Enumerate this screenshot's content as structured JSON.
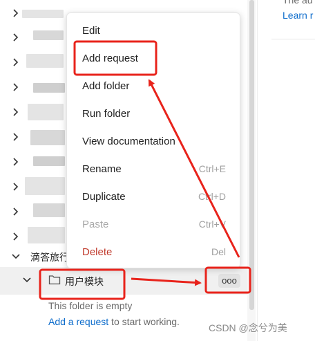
{
  "right_panel": {
    "partial_text": "The au",
    "learn_more": "Learn r"
  },
  "tree": {
    "group_label": "滴答旅行",
    "folder_name": "用户模块",
    "more_label": "ooo",
    "empty_message": "This folder is empty",
    "add_link": "Add a request",
    "add_suffix": " to start working."
  },
  "context_menu": {
    "items": [
      {
        "label": "Edit",
        "shortcut": ""
      },
      {
        "label": "Add request",
        "shortcut": ""
      },
      {
        "label": "Add folder",
        "shortcut": ""
      },
      {
        "label": "Run folder",
        "shortcut": ""
      },
      {
        "label": "View documentation",
        "shortcut": ""
      },
      {
        "label": "Rename",
        "shortcut": "Ctrl+E"
      },
      {
        "label": "Duplicate",
        "shortcut": "Ctrl+D"
      },
      {
        "label": "Paste",
        "shortcut": "Ctrl+V"
      },
      {
        "label": "Delete",
        "shortcut": "Del"
      }
    ]
  },
  "watermark": "CSDN @念兮为美",
  "colors": {
    "annotation": "#e8231b",
    "link": "#0b6bcb",
    "danger": "#c0392b"
  }
}
